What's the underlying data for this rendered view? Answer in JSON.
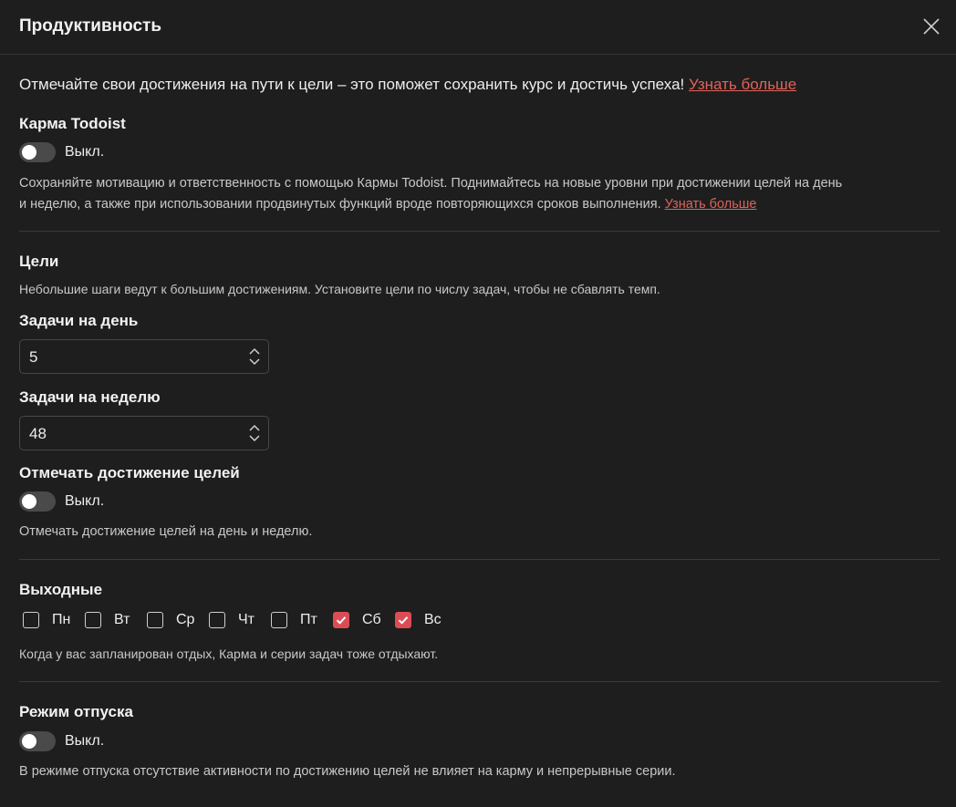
{
  "header": {
    "title": "Продуктивность"
  },
  "intro": {
    "text": "Отмечайте свои достижения на пути к цели – это поможет сохранить курс и достичь успеха! ",
    "link": "Узнать больше"
  },
  "karma": {
    "heading": "Карма Todoist",
    "toggle_label": "Выкл.",
    "toggle_on": false,
    "desc_line1": "Сохраняйте мотивацию и ответственность с помощью Кармы Todoist. Поднимайтесь на новые уровни при достижении целей на день",
    "desc_line2": "и неделю, а также при использовании продвинутых функций вроде повторяющихся сроков выполнения. ",
    "link": "Узнать больше"
  },
  "goals": {
    "heading": "Цели",
    "desc": "Небольшие шаги ведут к большим достижениям. Установите цели по числу задач, чтобы не сбавлять темп.",
    "daily_label": "Задачи на день",
    "daily_value": "5",
    "weekly_label": "Задачи на неделю",
    "weekly_value": "48",
    "celebrate_label": "Отмечать достижение целей",
    "celebrate_toggle_label": "Выкл.",
    "celebrate_on": false,
    "celebrate_desc": "Отмечать достижение целей на день и неделю."
  },
  "days_off": {
    "heading": "Выходные",
    "days": [
      {
        "label": "Пн",
        "checked": false
      },
      {
        "label": "Вт",
        "checked": false
      },
      {
        "label": "Ср",
        "checked": false
      },
      {
        "label": "Чт",
        "checked": false
      },
      {
        "label": "Пт",
        "checked": false
      },
      {
        "label": "Сб",
        "checked": true
      },
      {
        "label": "Вс",
        "checked": true
      }
    ],
    "desc": "Когда у вас запланирован отдых, Карма и серии задач тоже отдыхают."
  },
  "vacation": {
    "heading": "Режим отпуска",
    "toggle_label": "Выкл.",
    "toggle_on": false,
    "desc": "В режиме отпуска отсутствие активности по достижению целей не влияет на карму и непрерывные серии."
  },
  "colors": {
    "accent": "#dc4c55",
    "link": "#e0625a",
    "background": "#1e1e1e"
  },
  "icons": {
    "close": "close-icon",
    "stepper": "stepper-icon",
    "check": "check-icon"
  }
}
